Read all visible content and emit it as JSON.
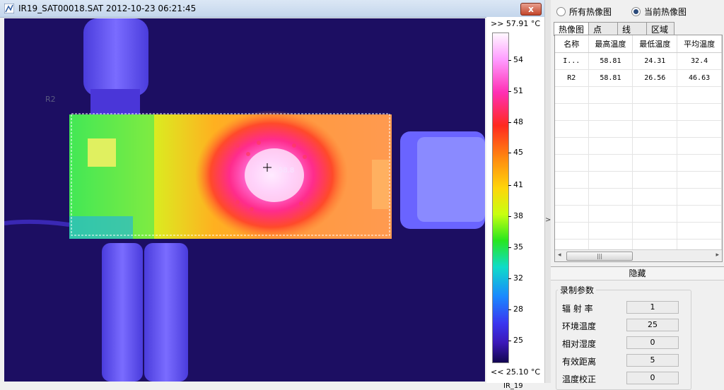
{
  "window": {
    "title": "IR19_SAT00018.SAT  2012-10-23 06:21:45",
    "close_label": "x"
  },
  "image": {
    "roi_label": "R2",
    "max_marker": "58.8"
  },
  "scale": {
    "max_label": ">> 57.91 °C",
    "min_label": "<< 25.10 °C",
    "ticks": [
      "54",
      "51",
      "48",
      "45",
      "41",
      "38",
      "35",
      "32",
      "28",
      "25"
    ],
    "name": "IR_19"
  },
  "splitter_arrow": ">",
  "view_options": {
    "all_images": "所有热像图",
    "current_image": "当前热像图",
    "selected": "current_image"
  },
  "tabs": [
    "热像图",
    "点",
    "线",
    "区域"
  ],
  "table": {
    "headers": [
      "名称",
      "最高温度",
      "最低温度",
      "平均温度"
    ],
    "rows": [
      [
        "I...",
        "58.81",
        "24.31",
        "32.4"
      ],
      [
        "R2",
        "58.81",
        "26.56",
        "46.63"
      ]
    ],
    "scroll_left": "◂",
    "scroll_right": "▸",
    "scroll_grip": "|||"
  },
  "hide_label": "隐藏",
  "params": {
    "title": "录制参数",
    "items": [
      {
        "label": "辐 射 率",
        "value": "1"
      },
      {
        "label": "环境温度",
        "value": "25"
      },
      {
        "label": "相对湿度",
        "value": "0"
      },
      {
        "label": "有效距离",
        "value": "5"
      },
      {
        "label": "温度校正",
        "value": "0"
      }
    ]
  }
}
